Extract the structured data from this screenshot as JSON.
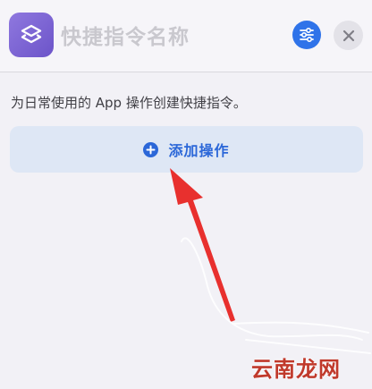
{
  "header": {
    "title": "快捷指令名称",
    "app_icon": "layers-icon",
    "filter_button_icon": "sliders-icon",
    "close_button_icon": "close-icon"
  },
  "main": {
    "description": "为日常使用的 App 操作创建快捷指令。",
    "add_action": {
      "label": "添加操作",
      "icon": "plus-circle-icon"
    }
  },
  "watermark": {
    "text": "云南龙网"
  },
  "colors": {
    "accent": "#2f73e9",
    "add_action_bg": "#dee7f5",
    "app_icon": "#7b63d6",
    "annotation_arrow": "#e8302e"
  }
}
